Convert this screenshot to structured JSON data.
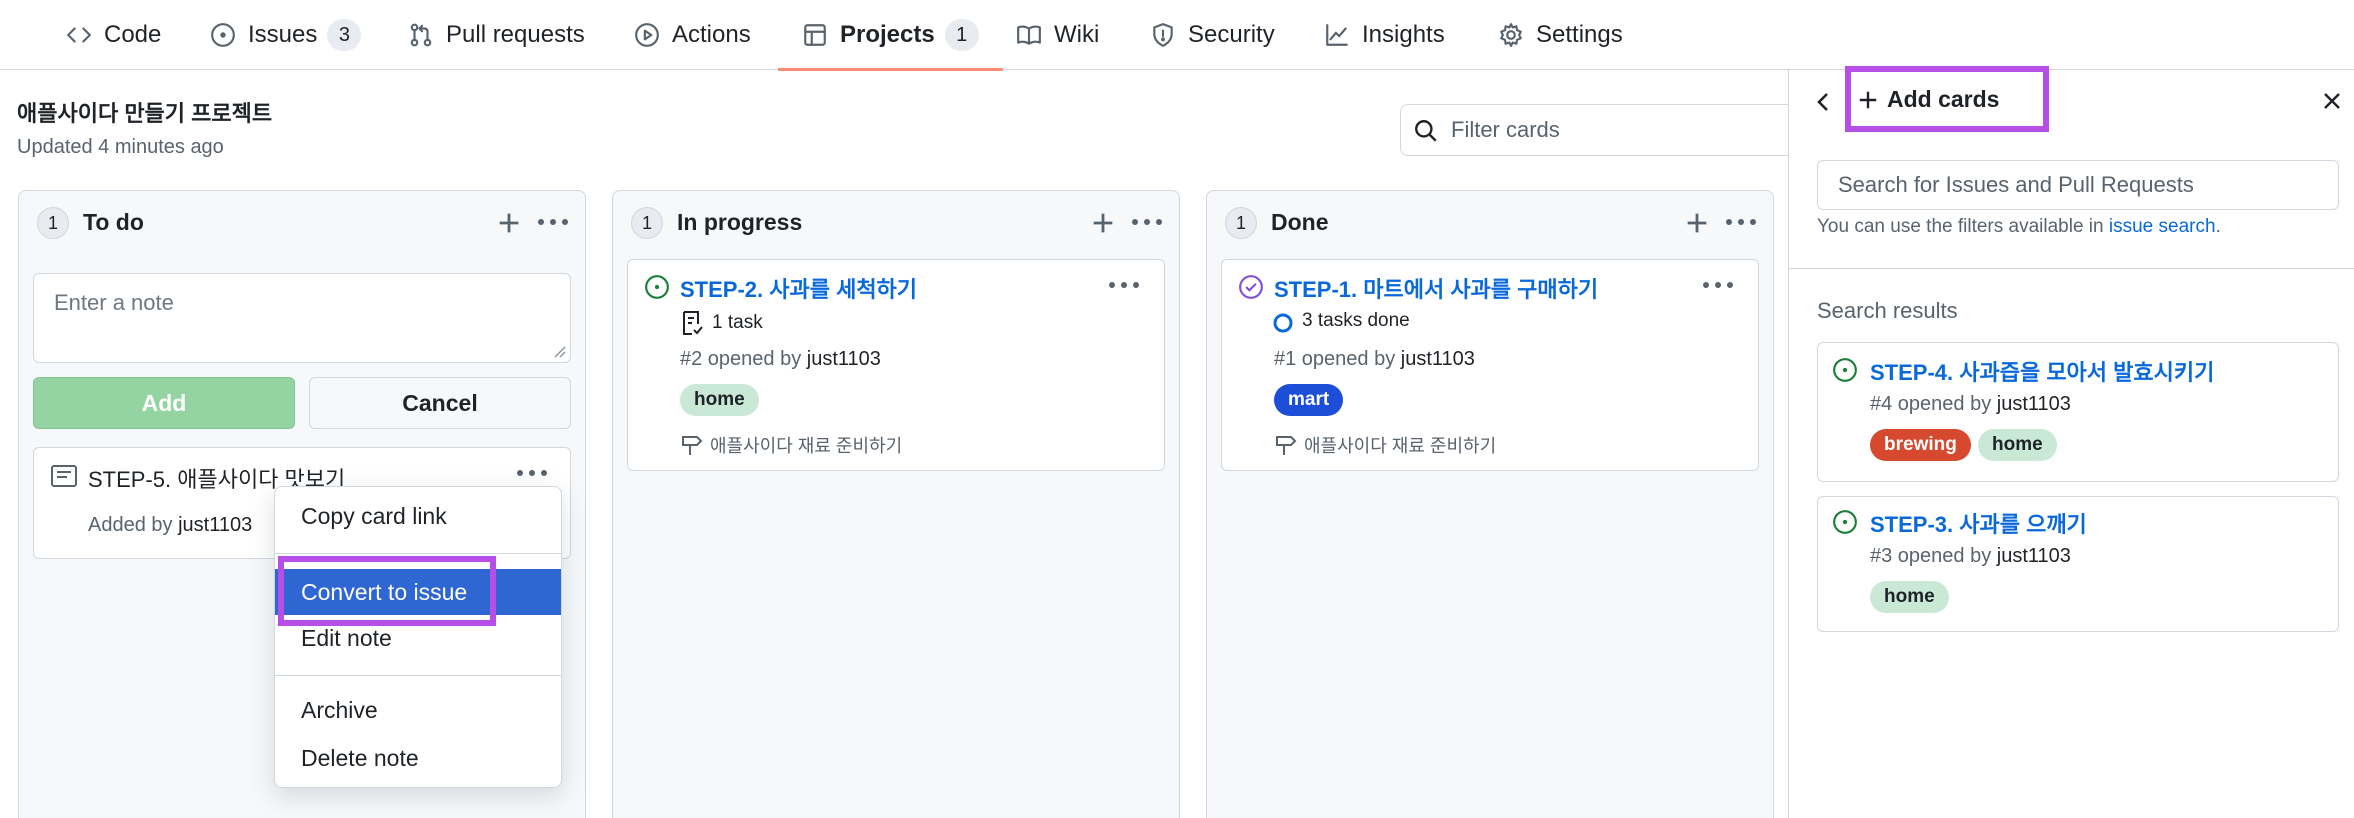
{
  "nav": {
    "tabs": [
      {
        "label": "Code",
        "icon": "code-icon"
      },
      {
        "label": "Issues",
        "icon": "issue-opened-icon",
        "count": "3"
      },
      {
        "label": "Pull requests",
        "icon": "git-pull-request-icon"
      },
      {
        "label": "Actions",
        "icon": "play-icon"
      },
      {
        "label": "Projects",
        "icon": "table-icon",
        "count": "1",
        "active": true
      },
      {
        "label": "Wiki",
        "icon": "book-icon"
      },
      {
        "label": "Security",
        "icon": "shield-icon"
      },
      {
        "label": "Insights",
        "icon": "graph-icon"
      },
      {
        "label": "Settings",
        "icon": "gear-icon"
      }
    ]
  },
  "project": {
    "title": "애플사이다 만들기 프로젝트",
    "updated": "Updated 4 minutes ago",
    "filter_placeholder": "Filter cards"
  },
  "columns": {
    "todo": {
      "count": "1",
      "name": "To do",
      "note_placeholder": "Enter a note",
      "add_label": "Add",
      "cancel_label": "Cancel",
      "note_card": {
        "title": "STEP-5. 애플사이다 맛보기",
        "added_prefix": "Added by",
        "author": "just1103"
      }
    },
    "in_progress": {
      "count": "1",
      "name": "In progress",
      "card": {
        "title": "STEP-2. 사과를 세척하기",
        "tasks": "1 task",
        "opened_prefix": "#2 opened by",
        "author": "just1103",
        "label": "home",
        "milestone": "애플사이다 재료 준비하기"
      }
    },
    "done": {
      "count": "1",
      "name": "Done",
      "card": {
        "title": "STEP-1. 마트에서 사과를 구매하기",
        "tasks": "3 tasks done",
        "opened_prefix": "#1 opened by",
        "author": "just1103",
        "label": "mart",
        "milestone": "애플사이다 재료 준비하기"
      }
    }
  },
  "context_menu": {
    "items": [
      "Copy card link",
      "Convert to issue",
      "Edit note",
      "Archive",
      "Delete note"
    ],
    "selected": "Convert to issue"
  },
  "side_panel": {
    "title": "Add cards",
    "search_placeholder": "Search for Issues and Pull Requests",
    "hint_prefix": "You can use the filters available in",
    "hint_link": "issue search",
    "hint_suffix": ".",
    "results_heading": "Search results",
    "results": [
      {
        "title": "STEP-4. 사과즙을 모아서 발효시키기",
        "opened_prefix": "#4 opened by",
        "author": "just1103",
        "labels": [
          "brewing",
          "home"
        ]
      },
      {
        "title": "STEP-3. 사과를 으깨기",
        "opened_prefix": "#3 opened by",
        "author": "just1103",
        "labels": [
          "home"
        ]
      }
    ]
  },
  "colors": {
    "link_blue": "#0969da",
    "open_green": "#1a7f37",
    "done_purple": "#8250df",
    "highlight": "#b84ee8",
    "label_home": "#c9e8d6",
    "label_mart": "#1d4ed8",
    "label_brewing": "#d6492f"
  }
}
